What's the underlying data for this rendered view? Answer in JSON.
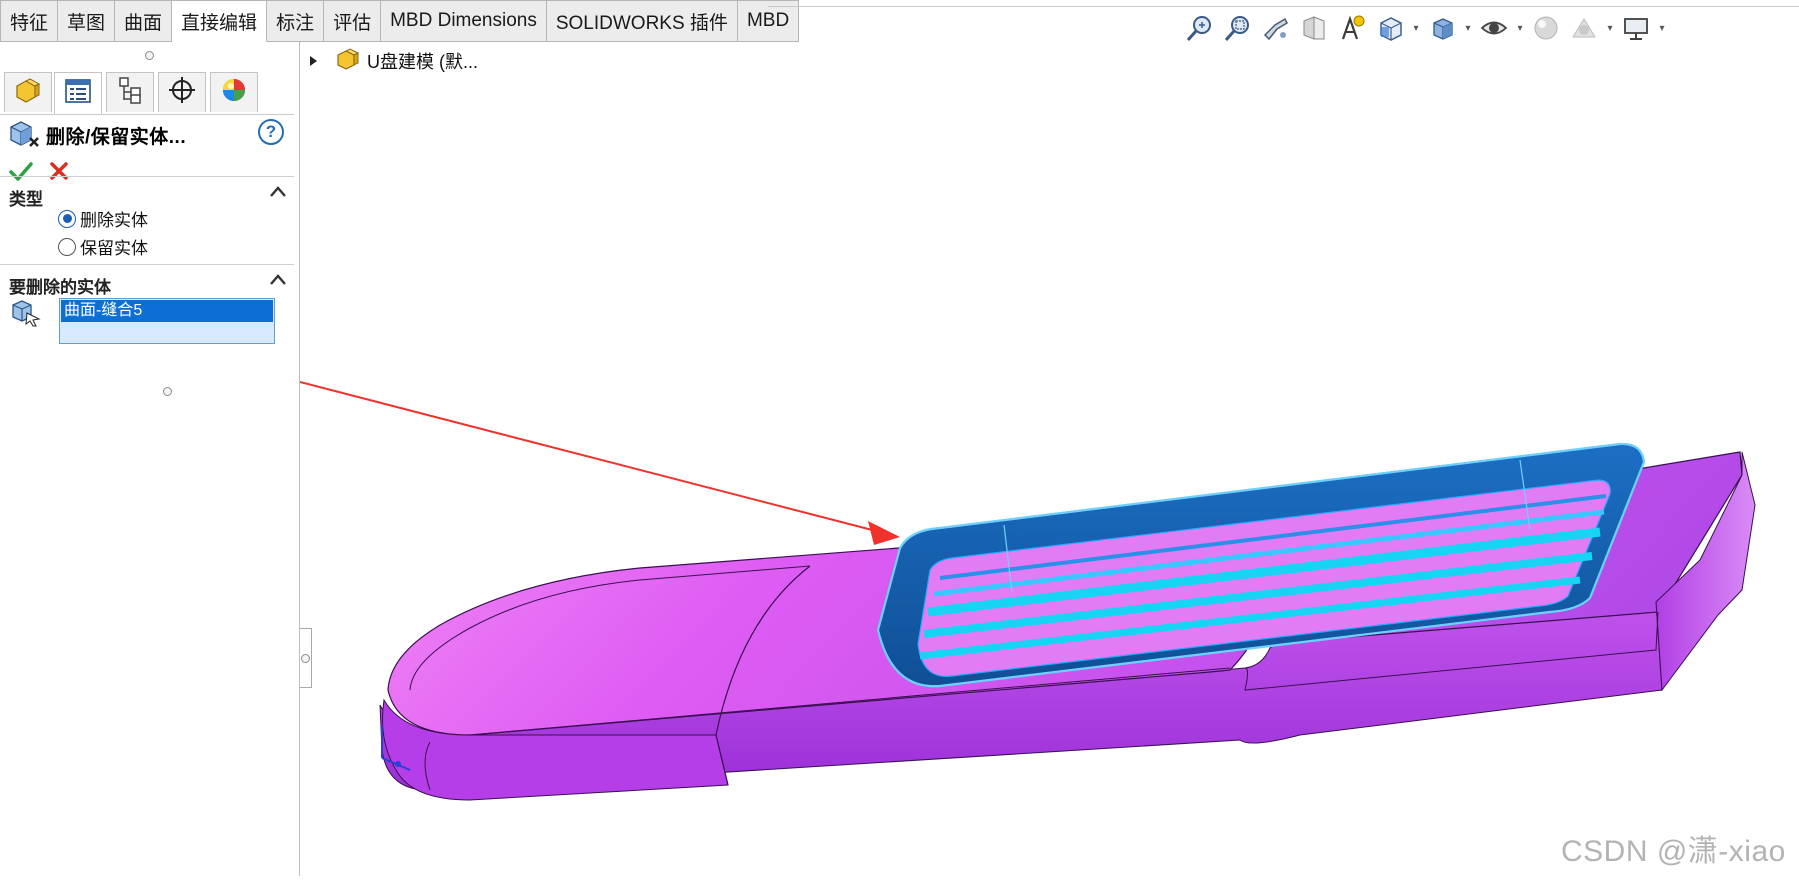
{
  "command_tabs": [
    "特征",
    "草图",
    "曲面",
    "直接编辑",
    "标注",
    "评估",
    "MBD Dimensions",
    "SOLIDWORKS 插件",
    "MBD"
  ],
  "active_tab_index": 3,
  "view_toolbar": {
    "buttons": [
      "zoom-to-fit-icon",
      "zoom-to-area-icon",
      "previous-view-icon",
      "section-view-icon",
      "dynamic-annotation-icon",
      "view-orientation-icon",
      "display-style-icon",
      "hide-show-items-icon",
      "edit-appearance-icon",
      "apply-scene-icon",
      "view-settings-icon"
    ]
  },
  "feature_tree": {
    "root_label": "U盘建模 (默..."
  },
  "property_manager": {
    "title": "删除/保留实体...",
    "help_label": "?",
    "type_group": {
      "title": "类型",
      "options": [
        {
          "label": "删除实体",
          "selected": true
        },
        {
          "label": "保留实体",
          "selected": false
        }
      ]
    },
    "bodies_group": {
      "title": "要删除的实体",
      "selected_items": [
        "曲面-缝合5"
      ]
    }
  },
  "colors": {
    "model_body": "#b14cf0",
    "model_body_light": "#f07bf7",
    "selected_surface": "#1e8fe0",
    "arrow": "#f0312c",
    "selection_highlight": "#0b6fd6"
  },
  "watermark": "CSDN @潇-xiao"
}
